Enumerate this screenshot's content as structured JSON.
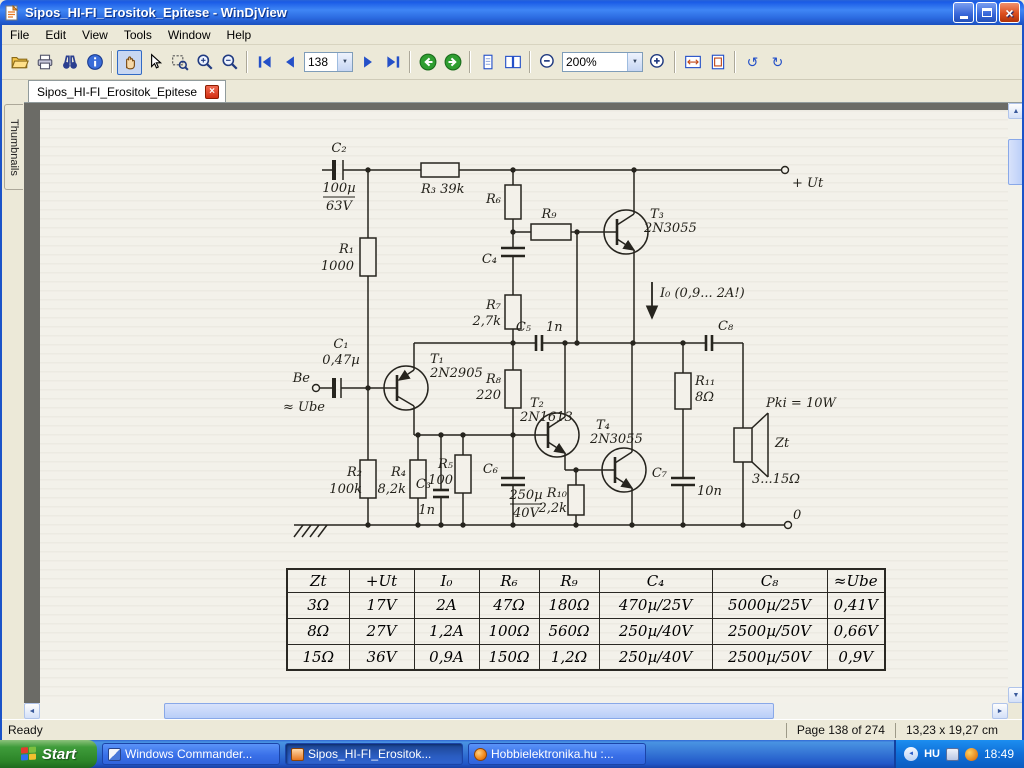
{
  "window": {
    "title": "Sipos_HI-FI_Erositok_Epitese - WinDjView"
  },
  "menu": {
    "items": [
      "File",
      "Edit",
      "View",
      "Tools",
      "Window",
      "Help"
    ]
  },
  "toolbar": {
    "page_value": "138",
    "zoom_value": "200%"
  },
  "tab": {
    "label": "Sipos_HI-FI_Erositok_Epitese"
  },
  "sidebar": {
    "thumbnails": "Thumbnails"
  },
  "statusbar": {
    "ready": "Ready",
    "page_info": "Page 138 of 274",
    "size_info": "13,23 x 19,27 cm"
  },
  "taskbar": {
    "start_label": "Start",
    "tasks": [
      "Windows Commander...",
      "Sipos_HI-FI_Erositok...",
      "Hobbielektronika.hu :..."
    ],
    "tray": {
      "lang": "HU",
      "clock": "18:49"
    }
  },
  "icons": {
    "close_glyph": "×",
    "dropdown_glyph": "▼",
    "up_glyph": "▲",
    "down_glyph": "▼",
    "left_glyph": "◄",
    "right_glyph": "►",
    "rotate_left_glyph": "↺",
    "rotate_right_glyph": "↻"
  },
  "schematic": {
    "c2_label": "C₂",
    "c2_top": "100µ",
    "c2_bot": "63V",
    "r3_label": "R₃ 39k",
    "r1_label": "R₁",
    "r1_value": "1000",
    "be_label": "Be",
    "ube_label": "≈ Ube",
    "c1_label": "C₁",
    "c1_value": "0,47µ",
    "t1_label": "T₁",
    "t1_type": "2N2905",
    "r2_label": "R₂",
    "r2_value": "100k",
    "r4_label": "R₄",
    "r4_value": "8,2k",
    "r5_label": "R₅",
    "r5_value": "100",
    "c3_label": "C₃",
    "c3_value": "1n",
    "r6_label": "R₆",
    "r9_label": "R₉",
    "c4_label": "C₄",
    "r7_label": "R₇",
    "r7_value": "2,7k",
    "c5_label": "C₅",
    "c5_value": "1n",
    "r8_label": "R₈",
    "r8_value": "220",
    "c6_label": "C₆",
    "c6_top": "250µ",
    "c6_bot": "40V",
    "r10_label": "R₁₀",
    "r10_value": "2,2k",
    "t2_label": "T₂",
    "t2_type": "2N1613",
    "t3_label": "T₃",
    "t3_type": "2N3055",
    "t4_label": "T₄",
    "t4_type": "2N3055",
    "i0_label": "I₀ (0,9... 2A!)",
    "c8_label": "C₈",
    "r11_label": "R₁₁",
    "r11_value": "8Ω",
    "c7_label": "C₇",
    "c7_value": "10n",
    "pki_label": "Pki = 10W",
    "zt_label": "Zt",
    "zt_value": "3...15Ω",
    "ut_label": "+ Ut",
    "zero_label": "0"
  },
  "table": {
    "headers": [
      "Zt",
      "+Ut",
      "I₀",
      "R₆",
      "R₉",
      "C₄",
      "C₈",
      "≈Ube"
    ],
    "rows": [
      [
        "3Ω",
        "17V",
        "2A",
        "47Ω",
        "180Ω",
        "470µ/25V",
        "5000µ/25V",
        "0,41V"
      ],
      [
        "8Ω",
        "27V",
        "1,2A",
        "100Ω",
        "560Ω",
        "250µ/40V",
        "2500µ/50V",
        "0,66V"
      ],
      [
        "15Ω",
        "36V",
        "0,9A",
        "150Ω",
        "1,2Ω",
        "250µ/40V",
        "2500µ/50V",
        "0,9V"
      ]
    ]
  }
}
